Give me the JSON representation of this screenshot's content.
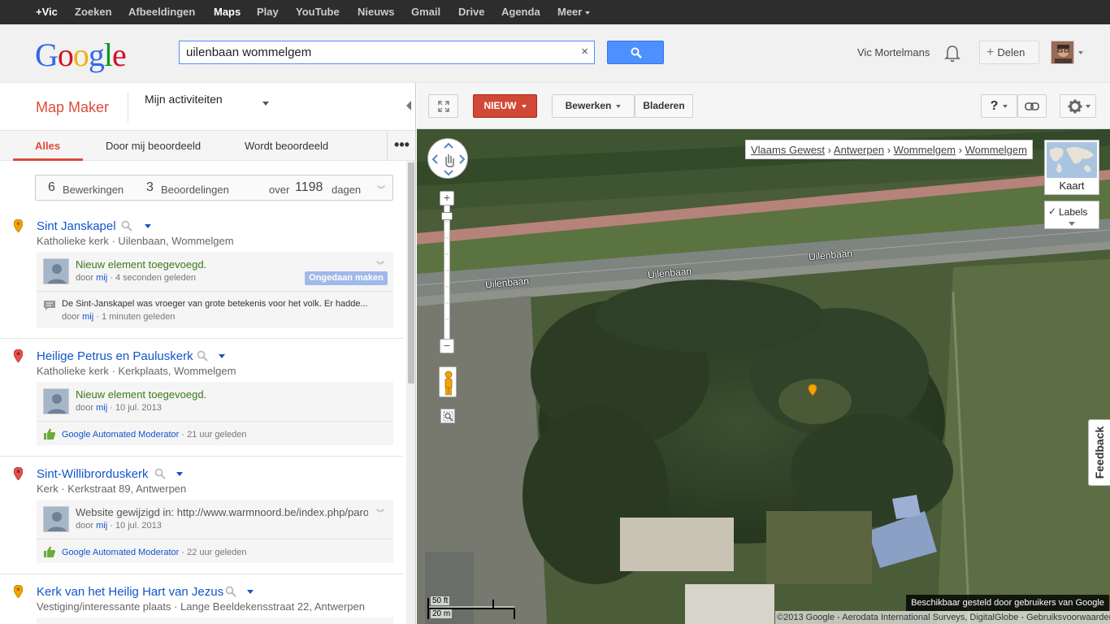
{
  "gbar": {
    "items": [
      "+Vic",
      "Zoeken",
      "Afbeeldingen",
      "Maps",
      "Play",
      "YouTube",
      "Nieuws",
      "Gmail",
      "Drive",
      "Agenda",
      "Meer"
    ]
  },
  "header": {
    "logo": [
      "G",
      "o",
      "o",
      "g",
      "l",
      "e"
    ],
    "search_value": "uilenbaan wommelgem",
    "clear": "×",
    "user_name": "Vic Mortelmans",
    "share_label": "Delen",
    "share_plus": "+"
  },
  "left": {
    "title": "Map Maker",
    "activity": "Mijn activiteiten",
    "tabs": [
      "Alles",
      "Door mij beoordeeld",
      "Wordt beoordeeld"
    ],
    "more": "•••",
    "stats": {
      "edits_count": "6",
      "edits_label": "Bewerkingen",
      "reviews_count": "3",
      "reviews_label": "Beoordelingen",
      "over": "over",
      "days_count": "1198",
      "days_label": "dagen",
      "chevron": "︾"
    },
    "entries": [
      {
        "title": "Sint Janskapel",
        "subtitle": "Katholieke kerk  ·  Uilenbaan, Wommelgem",
        "msg": "Nieuw element toegevoegd.",
        "by": "door",
        "by_link": "mij",
        "time": "·  4 seconden geleden",
        "undo": "Ongedaan maken",
        "comment": "De Sint-Janskapel was vroeger van grote betekenis voor het volk. Er hadde...",
        "comment_by": "door",
        "comment_by_link": "mij",
        "comment_time": "·  1 minuten geleden"
      },
      {
        "title": "Heilige Petrus en Pauluskerk",
        "subtitle": "Katholieke kerk  ·  Kerkplaats, Wommelgem",
        "msg": "Nieuw element toegevoegd.",
        "by": "door",
        "by_link": "mij",
        "time": "·  10 jul. 2013",
        "moderator": "Google Automated Moderator",
        "mod_time": "·  21 uur geleden"
      },
      {
        "title": "Sint-Willibrorduskerk",
        "subtitle": "Kerk  ·  Kerkstraat 89, Antwerpen",
        "msg": "Website gewijzigd in:  http://www.warmnoord.be/index.php/paroc...",
        "by": "door",
        "by_link": "mij",
        "time": "·  10 jul. 2013",
        "moderator": "Google Automated Moderator",
        "mod_time": "·  22 uur geleden"
      },
      {
        "title": "Kerk van het Heilig Hart van Jezus",
        "subtitle": "Vestiging/interessante plaats  ·  Lange Beeldekensstraat 22, Antwerpen"
      }
    ]
  },
  "toolbar": {
    "new_label": "NIEUW",
    "edit_label": "Bewerken",
    "browse_label": "Bladeren",
    "help_label": "?"
  },
  "map": {
    "breadcrumb": [
      "Vlaams Gewest",
      "Antwerpen",
      "Wommelgem",
      "Wommelgem"
    ],
    "breadcrumb_sep": "›",
    "map_type": "Kaart",
    "labels": "Labels",
    "labels_check": "✓",
    "zoom_in": "+",
    "zoom_out": "−",
    "road_labels": [
      "Uilenbaan",
      "Uilenbaan",
      "Uilenbaan"
    ],
    "feedback": "Feedback",
    "scale_top": "50 ft",
    "scale_bottom": "20 m",
    "attribution": "©2013 Google - Aerodata International Surveys, DigitalGlobe - Gebruiksvoorwaarden",
    "user_contrib": "Beschikbaar gesteld door gebruikers van Google"
  },
  "colors": {
    "accent_red": "#dd4b39",
    "link_blue": "#1155cc",
    "search_blue": "#4d90fe",
    "pin_orange": "#f4a300",
    "pin_red": "#e8504a"
  }
}
